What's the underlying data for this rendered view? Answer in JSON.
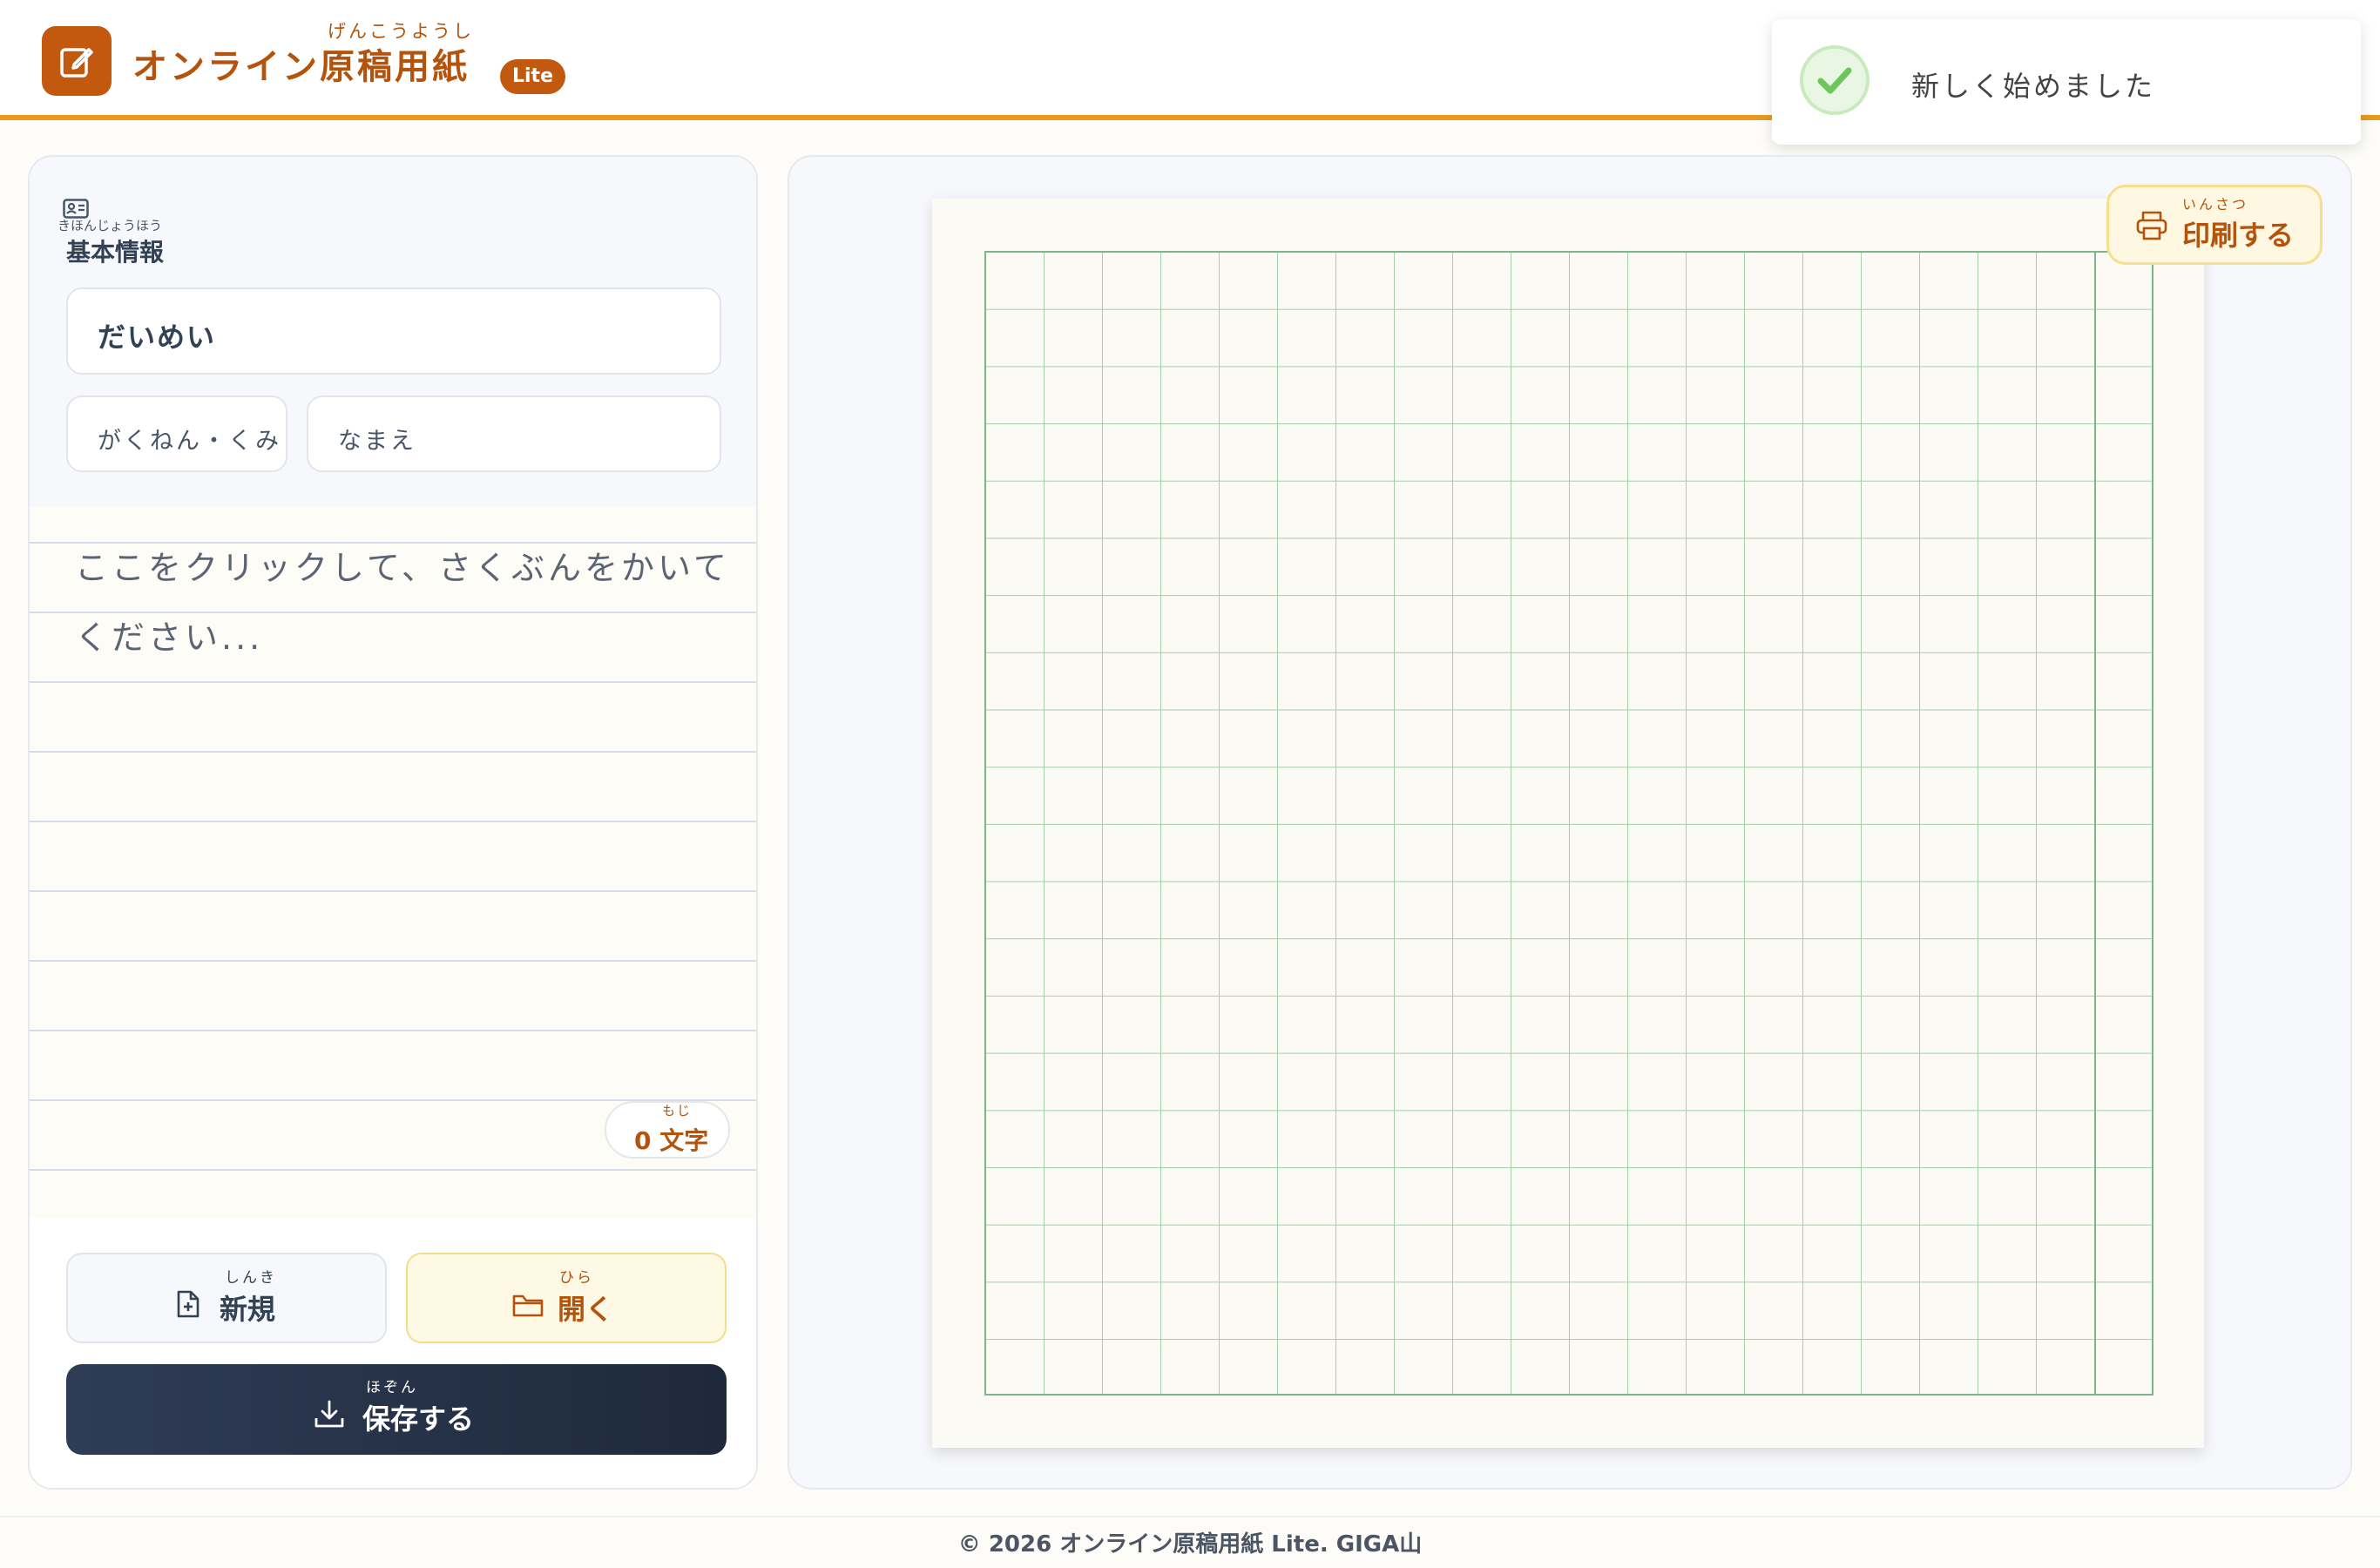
{
  "header": {
    "title": "オンライン原稿用紙",
    "title_ruby": "げんこうようし",
    "badge": "Lite",
    "brand_color": "#c2590f",
    "accent_line_color": "#e89a1f"
  },
  "toast": {
    "message": "新しく始めました",
    "icon": "check-circle-icon"
  },
  "info": {
    "ruby": "きほんじょうほう",
    "label": "基本情報",
    "title_placeholder": "だいめい",
    "grade_placeholder": "がくねん・くみ",
    "name_placeholder": "なまえ"
  },
  "editor": {
    "placeholder": "ここをクリックして、さくぶんをかいてください...",
    "char_count": "0 文字",
    "char_ruby": "もじ"
  },
  "actions": {
    "new_label": "新規",
    "new_ruby": "しんき",
    "open_label": "開く",
    "open_ruby": "ひら",
    "save_label": "保存する",
    "save_ruby": "ほぞん"
  },
  "preview": {
    "print_label": "印刷する",
    "print_ruby": "いんさつ",
    "grid_color": "#a6cfab"
  },
  "footer": {
    "text": "© 2026 オンライン原稿用紙 Lite. GIGA山"
  }
}
